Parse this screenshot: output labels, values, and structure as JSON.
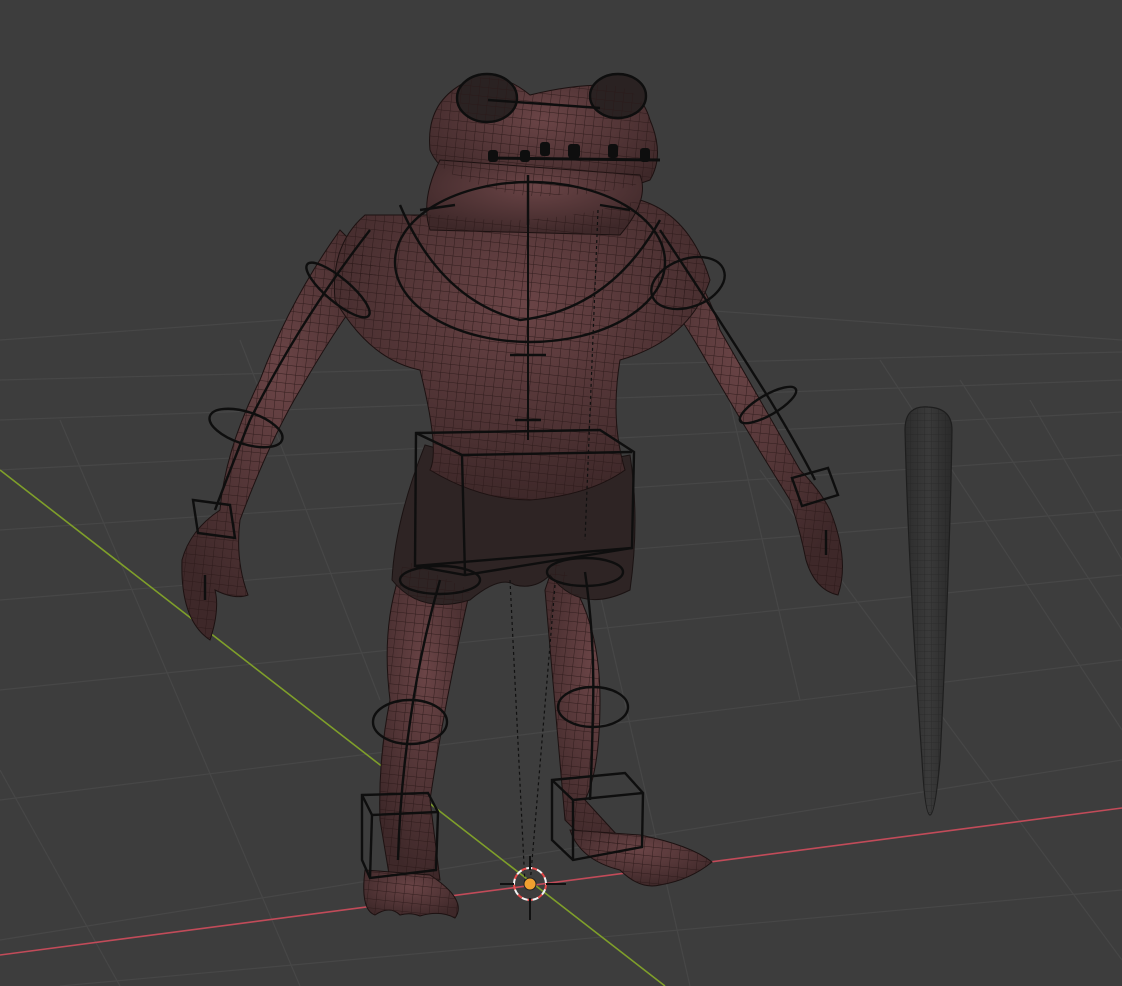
{
  "viewport": {
    "view": "3d-viewport",
    "shading": "solid-with-wireframe",
    "colors": {
      "background": "#3d3d3d",
      "grid": "#4a4a4a",
      "axis_x": "#c24b59",
      "axis_y": "#7f9f2a",
      "skin": "#5a3a3c",
      "rig": "#0e0e0e",
      "cursor_center": "#f0a030",
      "cursor_ring": "#e64a4a"
    }
  },
  "scene": {
    "objects": [
      {
        "name_hint": "frog-character-mesh",
        "type": "mesh"
      },
      {
        "name_hint": "armature-rig",
        "type": "armature"
      },
      {
        "name_hint": "tapered-stick-mesh",
        "type": "mesh"
      }
    ],
    "cursor": {
      "name_hint": "3d-cursor",
      "icon": "crosshair-icon"
    }
  }
}
